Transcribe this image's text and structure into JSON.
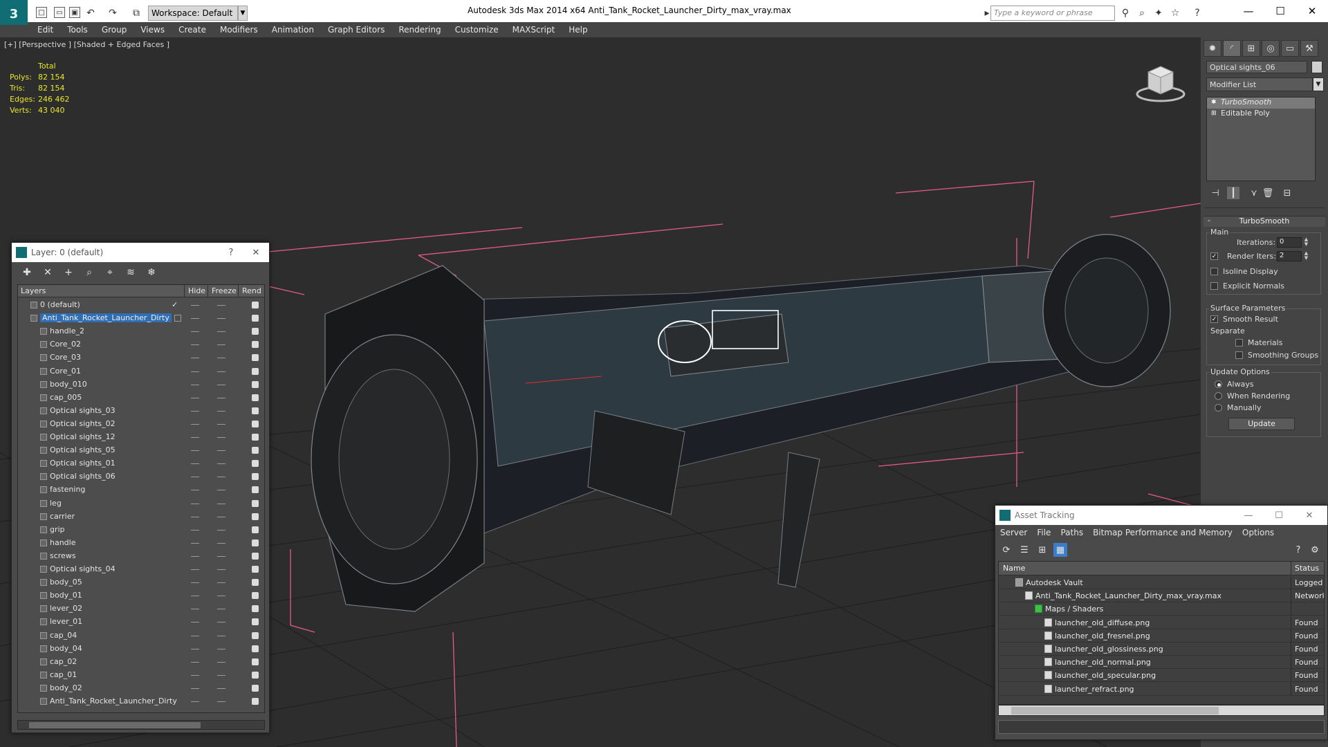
{
  "app": {
    "title": "Autodesk 3ds Max  2014 x64      Anti_Tank_Rocket_Launcher_Dirty_max_vray.max",
    "workspace": "Workspace: Default",
    "search_placeholder": "Type a keyword or phrase",
    "logo_glyph": "3"
  },
  "menu": [
    "Edit",
    "Tools",
    "Group",
    "Views",
    "Create",
    "Modifiers",
    "Animation",
    "Graph Editors",
    "Rendering",
    "Customize",
    "MAXScript",
    "Help"
  ],
  "viewport": {
    "label": "[+] [Perspective ] [Shaded + Edged Faces ]",
    "stats": {
      "header": "Total",
      "rows": [
        {
          "label": "Polys:",
          "value": "82 154"
        },
        {
          "label": "Tris:",
          "value": "82 154"
        },
        {
          "label": "Edges:",
          "value": "246 462"
        },
        {
          "label": "Verts:",
          "value": "43 040"
        }
      ]
    }
  },
  "command_panel": {
    "object_name": "Optical sights_06",
    "modifier_list": "Modifier List",
    "stack": [
      {
        "label": "TurboSmooth",
        "selected": true
      },
      {
        "label": "Editable Poly",
        "selected": false
      }
    ],
    "rollout_title": "TurboSmooth",
    "main_label": "Main",
    "iterations_label": "Iterations:",
    "iterations_value": "0",
    "render_iters_label": "Render Iters:",
    "render_iters_value": "2",
    "isoline_label": "Isoline Display",
    "explicit_label": "Explicit Normals",
    "surface_label": "Surface Parameters",
    "smooth_result_label": "Smooth Result",
    "separate_label": "Separate",
    "materials_label": "Materials",
    "smoothing_label": "Smoothing Groups",
    "update_options_label": "Update Options",
    "always_label": "Always",
    "when_rendering_label": "When Rendering",
    "manually_label": "Manually",
    "update_button": "Update"
  },
  "layer_dialog": {
    "title": "Layer: 0 (default)",
    "help": "?",
    "close": "✕",
    "columns": {
      "layers": "Layers",
      "hide": "Hide",
      "freeze": "Freeze",
      "render": "Rend"
    },
    "rows": [
      {
        "name": "0 (default)",
        "level": 0,
        "selected": false,
        "current": true
      },
      {
        "name": "Anti_Tank_Rocket_Launcher_Dirty",
        "level": 0,
        "selected": true,
        "current": false
      },
      {
        "name": "handle_2",
        "level": 1
      },
      {
        "name": "Core_02",
        "level": 1
      },
      {
        "name": "Core_03",
        "level": 1
      },
      {
        "name": "Core_01",
        "level": 1
      },
      {
        "name": "body_010",
        "level": 1
      },
      {
        "name": "cap_005",
        "level": 1
      },
      {
        "name": "Optical sights_03",
        "level": 1
      },
      {
        "name": "Optical sights_02",
        "level": 1
      },
      {
        "name": "Optical sights_12",
        "level": 1
      },
      {
        "name": "Optical sights_05",
        "level": 1
      },
      {
        "name": "Optical sights_01",
        "level": 1
      },
      {
        "name": "Optical sights_06",
        "level": 1
      },
      {
        "name": "fastening",
        "level": 1
      },
      {
        "name": "leg",
        "level": 1
      },
      {
        "name": "carrier",
        "level": 1
      },
      {
        "name": "grip",
        "level": 1
      },
      {
        "name": "handle",
        "level": 1
      },
      {
        "name": "screws",
        "level": 1
      },
      {
        "name": "Optical sights_04",
        "level": 1
      },
      {
        "name": "body_05",
        "level": 1
      },
      {
        "name": "body_01",
        "level": 1
      },
      {
        "name": "lever_02",
        "level": 1
      },
      {
        "name": "lever_01",
        "level": 1
      },
      {
        "name": "cap_04",
        "level": 1
      },
      {
        "name": "body_04",
        "level": 1
      },
      {
        "name": "cap_02",
        "level": 1
      },
      {
        "name": "cap_01",
        "level": 1
      },
      {
        "name": "body_02",
        "level": 1
      },
      {
        "name": "Anti_Tank_Rocket_Launcher_Dirty",
        "level": 1
      }
    ]
  },
  "asset_dialog": {
    "title": "Asset Tracking",
    "menu": [
      "Server",
      "File",
      "Paths",
      "Bitmap Performance and Memory",
      "Options"
    ],
    "columns": {
      "name": "Name",
      "status": "Status"
    },
    "rows": [
      {
        "name": "Autodesk Vault",
        "level": 1,
        "status": "Logged O"
      },
      {
        "name": "Anti_Tank_Rocket_Launcher_Dirty_max_vray.max",
        "level": 2,
        "status": "Network"
      },
      {
        "name": "Maps / Shaders",
        "level": 3,
        "status": ""
      },
      {
        "name": "launcher_old_diffuse.png",
        "level": 4,
        "status": "Found"
      },
      {
        "name": "launcher_old_fresnel.png",
        "level": 4,
        "status": "Found"
      },
      {
        "name": "launcher_old_glossiness.png",
        "level": 4,
        "status": "Found"
      },
      {
        "name": "launcher_old_normal.png",
        "level": 4,
        "status": "Found"
      },
      {
        "name": "launcher_old_specular.png",
        "level": 4,
        "status": "Found"
      },
      {
        "name": "launcher_refract.png",
        "level": 4,
        "status": "Found"
      }
    ]
  },
  "colors": {
    "accent": "#0f6d73",
    "selection": "#2f6db5",
    "stats": "#e8e828",
    "bbox": "#e65a8c"
  }
}
